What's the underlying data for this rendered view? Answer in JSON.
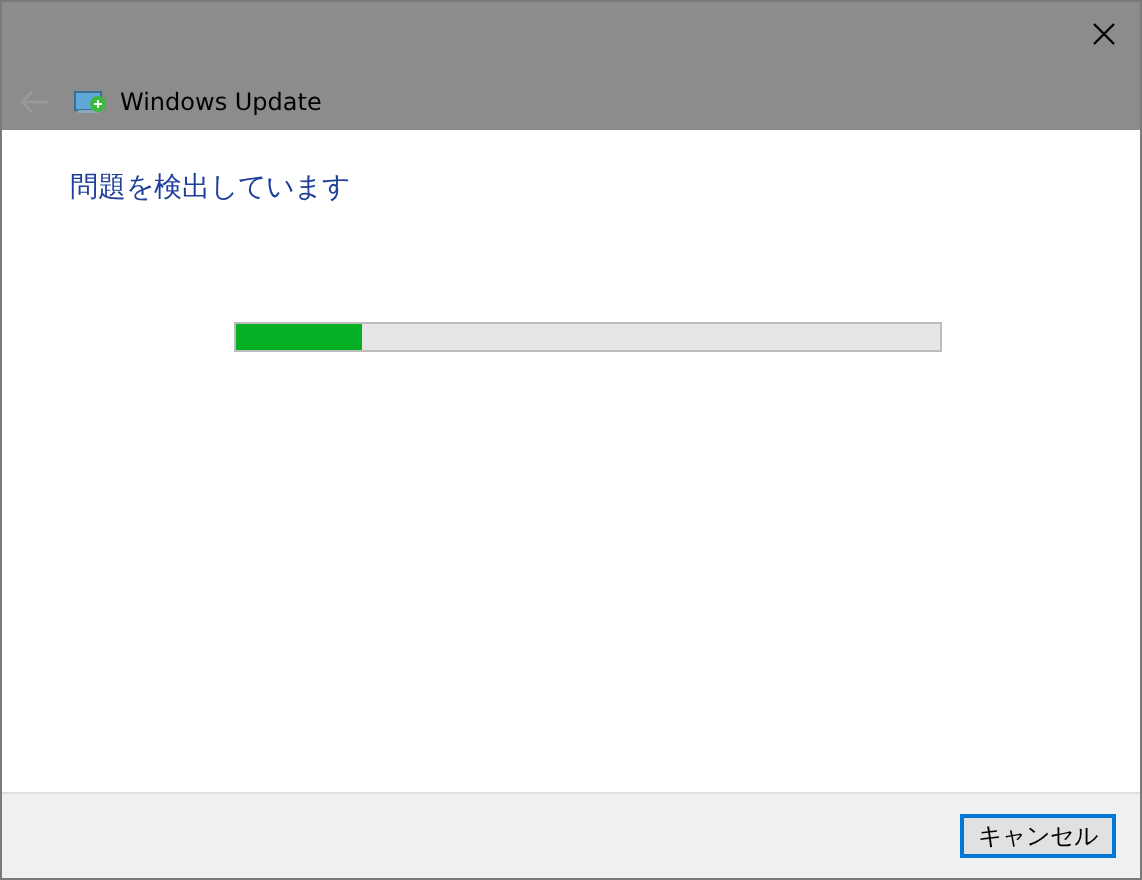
{
  "header": {
    "title": "Windows Update",
    "back_disabled": true
  },
  "heading": "問題を検出しています",
  "progress": {
    "level": 0.18
  },
  "buttons": [
    {
      "label": "キャンセル",
      "focused": true
    }
  ]
}
